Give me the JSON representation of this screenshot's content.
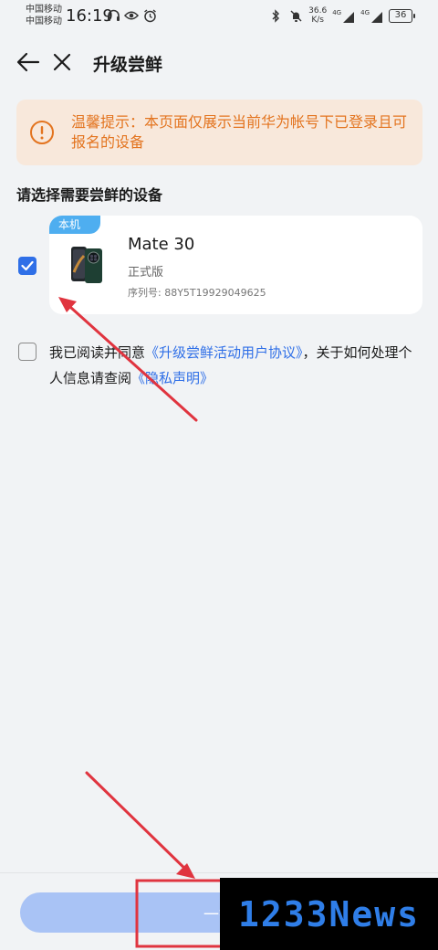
{
  "status_bar": {
    "carrier1": "中国移动",
    "carrier2": "中国移动",
    "time": "16:19",
    "net_speed_value": "36.6",
    "net_speed_unit": "K/s",
    "signal1_label": "4G",
    "signal2_label": "4G",
    "battery": "36"
  },
  "header": {
    "title": "升级尝鲜"
  },
  "tip": {
    "text": "温馨提示：本页面仅展示当前华为帐号下已登录且可报名的设备"
  },
  "section": {
    "title": "请选择需要尝鲜的设备"
  },
  "device": {
    "badge": "本机",
    "name": "Mate 30",
    "edition": "正式版",
    "serial_label": "序列号:",
    "serial": "88Y5T19929049625",
    "checked": true
  },
  "agreement": {
    "prefix": "我已阅读并同意",
    "link1": "《升级尝鲜活动用户协议》",
    "middle": "，关于如何处理个人信息请查阅",
    "link2": "《隐私声明》",
    "checked": false
  },
  "bottom": {
    "button_label": "一键"
  },
  "watermark": {
    "text": "1233News"
  },
  "colors": {
    "accent": "#2f6fe7",
    "tip_text": "#e3741f",
    "tip_bg": "#f8e8db",
    "badge": "#4eaef0",
    "annotation": "#e0343f"
  }
}
